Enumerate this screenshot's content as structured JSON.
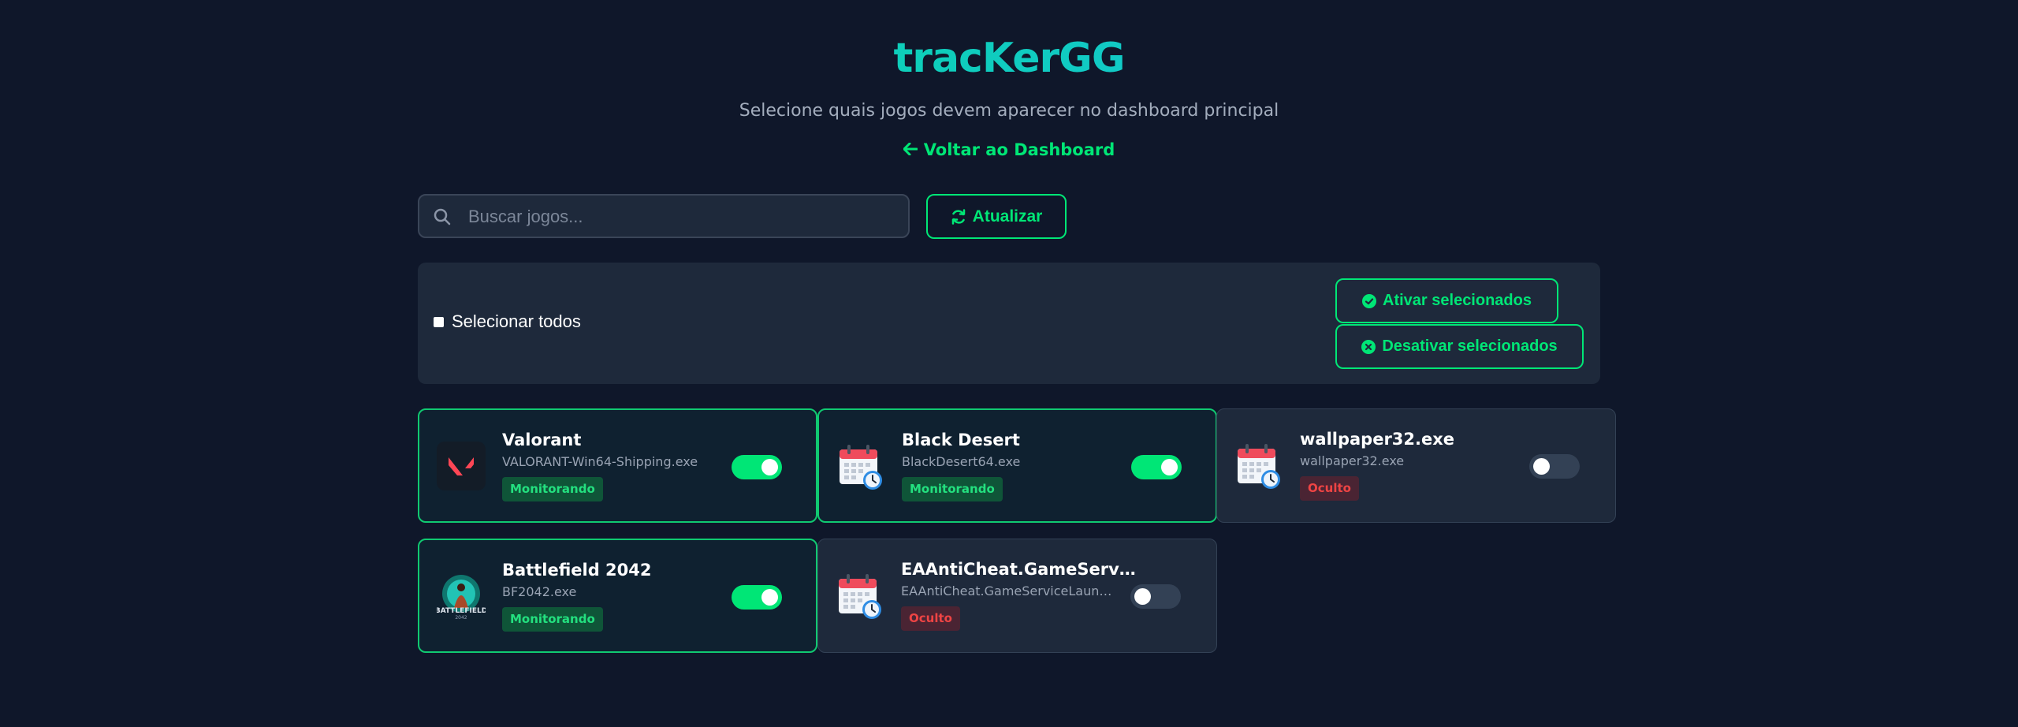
{
  "header": {
    "title": "tracKerGG",
    "subtitle": "Selecione quais jogos devem aparecer no dashboard principal",
    "back_link": "Voltar ao Dashboard"
  },
  "search": {
    "placeholder": "Buscar jogos...",
    "value": ""
  },
  "refresh_button": "Atualizar",
  "bulk": {
    "select_all": "Selecionar todos",
    "select_all_checked": false,
    "activate": "Ativar selecionados",
    "deactivate": "Desativar selecionados"
  },
  "games": [
    {
      "name": "Valorant",
      "exe": "VALORANT-Win64-Shipping.exe",
      "status": "Monitorando",
      "enabled": true,
      "icon": "valorant-icon"
    },
    {
      "name": "Black Desert",
      "exe": "BlackDesert64.exe",
      "status": "Monitorando",
      "enabled": true,
      "icon": "calendar-clock-icon"
    },
    {
      "name": "wallpaper32.exe",
      "exe": "wallpaper32.exe",
      "status": "Oculto",
      "enabled": false,
      "icon": "calendar-clock-icon"
    },
    {
      "name": "Battlefield 2042",
      "exe": "BF2042.exe",
      "status": "Monitorando",
      "enabled": true,
      "icon": "battlefield-icon",
      "icon_text": "BATTLEFIELD"
    },
    {
      "name": "EAAntiCheat.GameServic...",
      "exe": "EAAntiCheat.GameServiceLaunc...",
      "status": "Oculto",
      "enabled": false,
      "icon": "calendar-clock-icon"
    }
  ],
  "colors": {
    "background": "#0f172a",
    "panel": "#1e293b",
    "accent": "#00e676",
    "accent_blue": "#1fb8f5",
    "danger": "#ef4444"
  }
}
